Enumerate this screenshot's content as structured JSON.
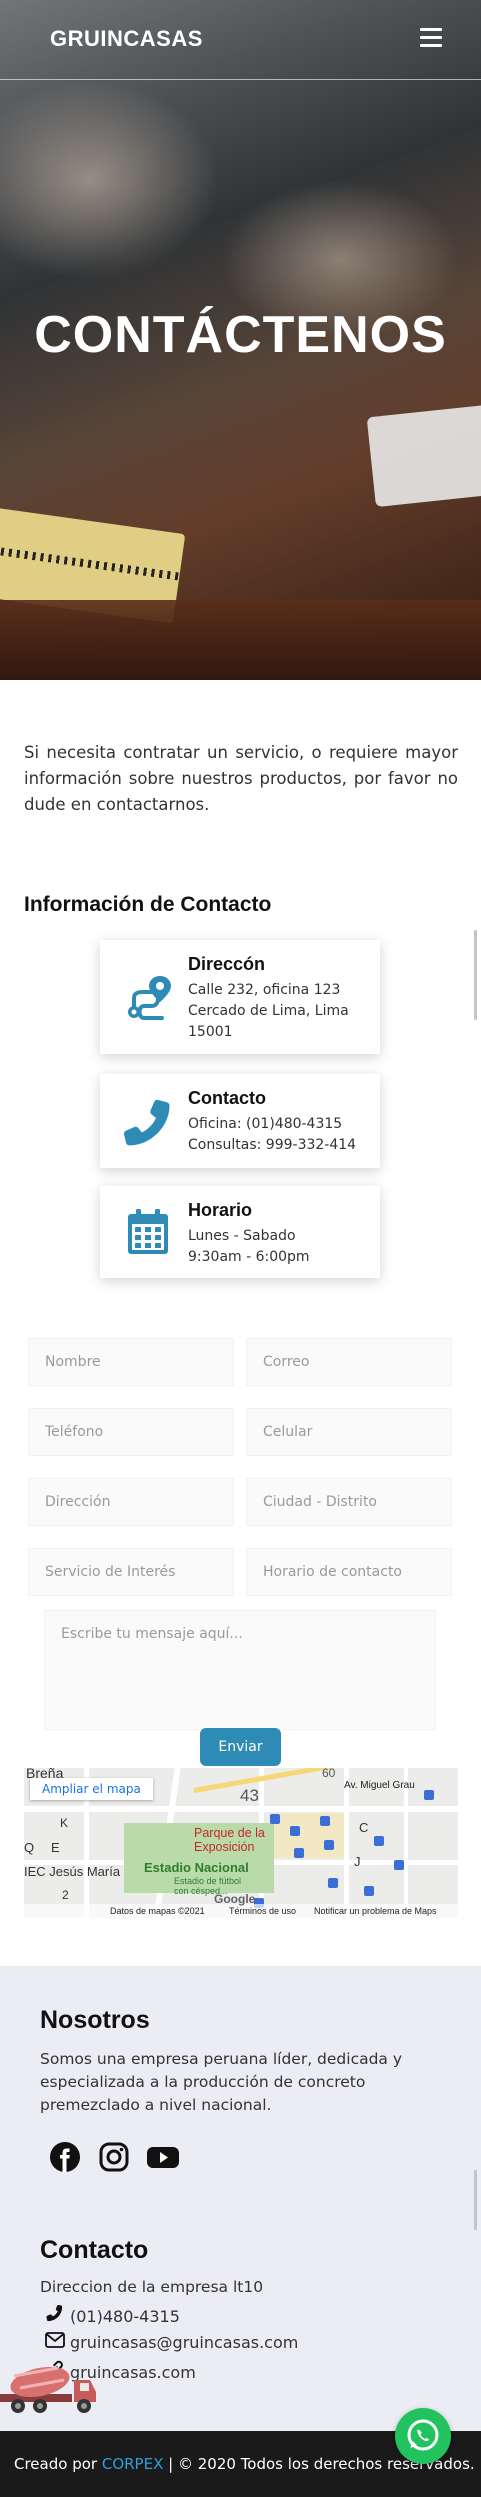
{
  "header": {
    "logo": "GRUINCASAS",
    "menu_icon": "hamburger-icon"
  },
  "hero": {
    "title": "CONTÁCTENOS"
  },
  "intro": {
    "text": "Si necesita contratar un servicio, o requiere mayor información sobre nuestros productos, por favor no dude en contactarnos."
  },
  "contact_info": {
    "title": "Información de Contacto",
    "cards": [
      {
        "icon": "route-icon",
        "title": "Direccón",
        "lines": [
          "Calle 232, oficina 123",
          "Cercado de Lima, Lima",
          "15001"
        ]
      },
      {
        "icon": "phone-icon",
        "title": "Contacto",
        "lines": [
          "Oficina: (01)480-4315",
          "Consultas: 999-332-414"
        ]
      },
      {
        "icon": "calendar-icon",
        "title": "Horario",
        "lines": [
          "Lunes - Sabado",
          "9:30am - 6:00pm"
        ]
      }
    ]
  },
  "form": {
    "fields": [
      {
        "placeholder": "Nombre"
      },
      {
        "placeholder": "Correo"
      },
      {
        "placeholder": "Teléfono"
      },
      {
        "placeholder": "Celular"
      },
      {
        "placeholder": "Dirección"
      },
      {
        "placeholder": "Ciudad - Distrito"
      },
      {
        "placeholder": "Servicio de Interés"
      },
      {
        "placeholder": "Horario de contacto"
      }
    ],
    "message_placeholder": "Escribe tu mensaje aquí...",
    "submit_label": "Enviar"
  },
  "map": {
    "enlarge_label": "Ampliar el mapa",
    "labels": {
      "brena": "Breña",
      "av_grau": "Av. Miguel Grau",
      "park": "Parque de la Exposición",
      "stadium": "Estadio Nacional",
      "stadium_sub": "Estadio de fútbol con césped...",
      "jesus_maria": "IEC Jesús María",
      "n43": "43",
      "n60": "60",
      "k": "K",
      "q": "Q",
      "e": "E",
      "c": "C",
      "j": "J",
      "n2": "2"
    },
    "footer": {
      "data": "Datos de mapas ©2021",
      "terms": "Términos de uso",
      "report": "Notificar un problema de Maps",
      "brand": "Google"
    }
  },
  "footer": {
    "about_title": "Nosotros",
    "about_text": "Somos una empresa peruana líder, dedicada y especializada a la producción de concreto premezclado a nivel nacional.",
    "social": [
      "facebook-icon",
      "instagram-icon",
      "youtube-icon"
    ],
    "contact_title": "Contacto",
    "address": "Direccion de la empresa lt10",
    "phone": "(01)480-4315",
    "email": "gruincasas@gruincasas.com",
    "website": "gruincasas.com",
    "credits_prefix": "Creado por",
    "credits_link": "CORPEX",
    "credits_suffix": "| © 2020 Todos los derechos reservados."
  },
  "colors": {
    "accent": "#2e8bb5",
    "icon_blue": "#2e8bb5",
    "whatsapp": "#22c35e",
    "footer_bg": "#ececf5",
    "bottom_bg": "#1a1a1a"
  }
}
